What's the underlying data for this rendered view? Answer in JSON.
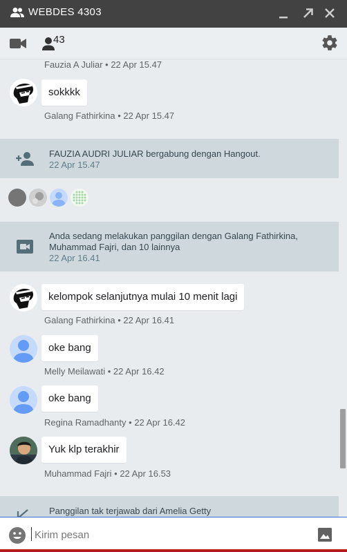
{
  "titlebar": {
    "title": "WEBDES 4303",
    "group_icon": "group-icon",
    "buttons": [
      "minimize-icon",
      "popout-icon",
      "close-icon"
    ]
  },
  "toolbar": {
    "video_icon": "video-call-icon",
    "participant_count": "43",
    "settings_icon": "gear-icon"
  },
  "feed": {
    "top_meta": {
      "sender": "Fauzia A Juliar",
      "time": "22 Apr 15.47"
    },
    "messages": [
      {
        "text": "sokkkk",
        "sender": "Galang Fathirkina",
        "time": "22 Apr 15.47",
        "avatar": "anime-avatar"
      },
      {
        "text": "kelompok selanjutnya mulai 10 menit lagi",
        "sender": "Galang Fathirkina",
        "time": "22 Apr 16.41",
        "avatar": "anime-avatar"
      },
      {
        "text": "oke bang",
        "sender": "Melly Meilawati",
        "time": "22 Apr 16.42",
        "avatar": "default-avatar"
      },
      {
        "text": "oke bang",
        "sender": "Regina Ramadhanty",
        "time": "22 Apr 16.42",
        "avatar": "default-avatar"
      },
      {
        "text": "Yuk klp terakhir",
        "sender": "Muhammad Fajri",
        "time": "22 Apr 16.53",
        "avatar": "photo-avatar"
      }
    ],
    "system": [
      {
        "icon": "person-add-icon",
        "text": "FAUZIA AUDRI JULIAR bergabung dengan Hangout.",
        "time": "22 Apr 15.47"
      },
      {
        "icon": "video-call-icon",
        "text_line1": "Anda sedang melakukan panggilan dengan Galang Fathirkina,",
        "text_line2": "Muhammad Fajri, dan 10 lainnya",
        "time": "22 Apr 16.41"
      },
      {
        "icon": "missed-call-icon",
        "text": "Panggilan tak terjawab dari Amelia Getty"
      }
    ],
    "read_receipts": [
      "gray-avatar",
      "photo-avatar",
      "default-avatar",
      "pattern-avatar"
    ]
  },
  "composer": {
    "placeholder": "Kirim pesan",
    "emoji_icon": "emoji-icon",
    "image_icon": "image-icon"
  },
  "colors": {
    "titlebar": "#424242",
    "toolbar": "#eceff1",
    "feed": "#e8ecef",
    "system": "#cfd8dc",
    "avatar_blue": "#8ab4f8",
    "composer_border": "#3b6fd8"
  }
}
